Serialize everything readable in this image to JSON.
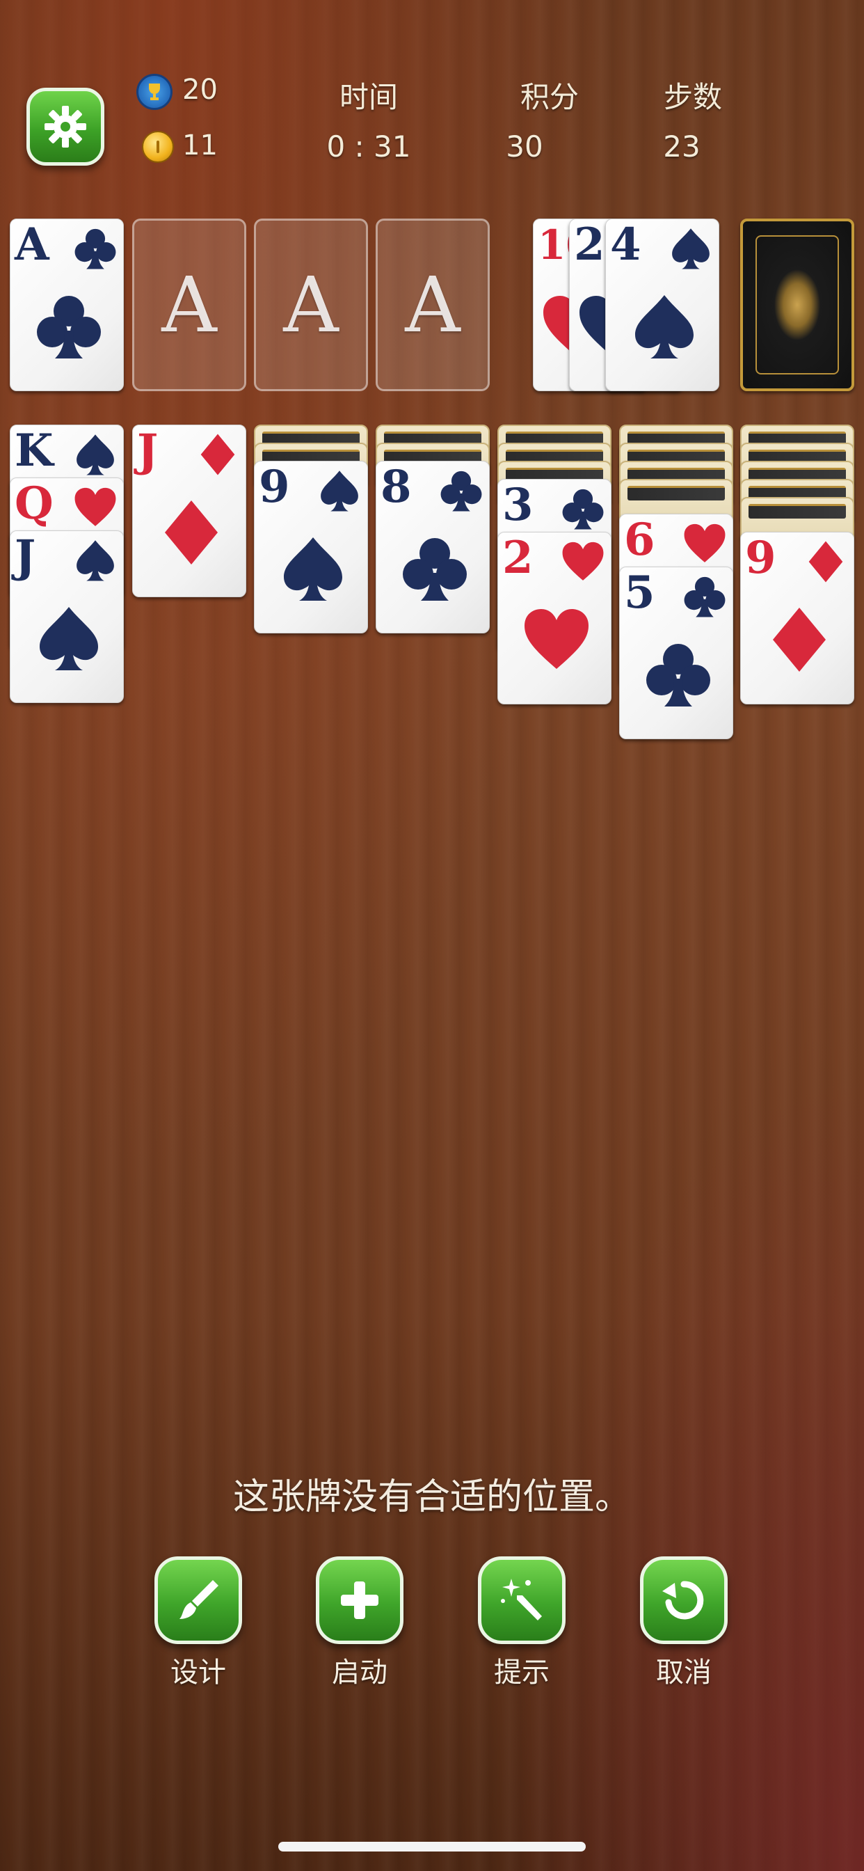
{
  "header": {
    "trophy_count": "20",
    "coin_count": "11",
    "time_label": "时间",
    "time_value": "0 : 31",
    "score_label": "积分",
    "score_value": "30",
    "moves_label": "步数",
    "moves_value": "23"
  },
  "icons": {
    "settings": "gear-icon",
    "trophy": "trophy-icon",
    "coin": "coin-icon",
    "design": "paintbrush-icon",
    "start": "plus-icon",
    "hint": "magic-wand-icon",
    "undo": "undo-icon"
  },
  "foundations": [
    {
      "rank": "A",
      "suit": "clubs",
      "color": "blue"
    },
    {
      "placeholder": "A"
    },
    {
      "placeholder": "A"
    },
    {
      "placeholder": "A"
    }
  ],
  "waste": [
    {
      "rank": "10",
      "suit": "hearts",
      "color": "red"
    },
    {
      "rank": "2",
      "suit": "hearts",
      "color": "red"
    },
    {
      "rank": "4",
      "suit": "spades",
      "color": "blue"
    }
  ],
  "tableau": [
    {
      "facedown": 0,
      "cards": [
        {
          "rank": "K",
          "suit": "spades"
        },
        {
          "rank": "Q",
          "suit": "hearts"
        },
        {
          "rank": "J",
          "suit": "spades"
        }
      ]
    },
    {
      "facedown": 0,
      "cards": [
        {
          "rank": "J",
          "suit": "diamonds"
        }
      ]
    },
    {
      "facedown": 2,
      "cards": [
        {
          "rank": "9",
          "suit": "spades"
        }
      ]
    },
    {
      "facedown": 2,
      "cards": [
        {
          "rank": "8",
          "suit": "clubs"
        }
      ]
    },
    {
      "facedown": 3,
      "cards": [
        {
          "rank": "3",
          "suit": "clubs"
        },
        {
          "rank": "2",
          "suit": "hearts"
        }
      ]
    },
    {
      "facedown": 4,
      "cards": [
        {
          "rank": "6",
          "suit": "hearts"
        },
        {
          "rank": "5",
          "suit": "clubs"
        }
      ]
    },
    {
      "facedown": 5,
      "cards": [
        {
          "rank": "9",
          "suit": "diamonds"
        }
      ]
    }
  ],
  "message": "这张牌没有合适的位置。",
  "actions": [
    {
      "label": "设计"
    },
    {
      "label": "启动"
    },
    {
      "label": "提示"
    },
    {
      "label": "取消"
    }
  ]
}
